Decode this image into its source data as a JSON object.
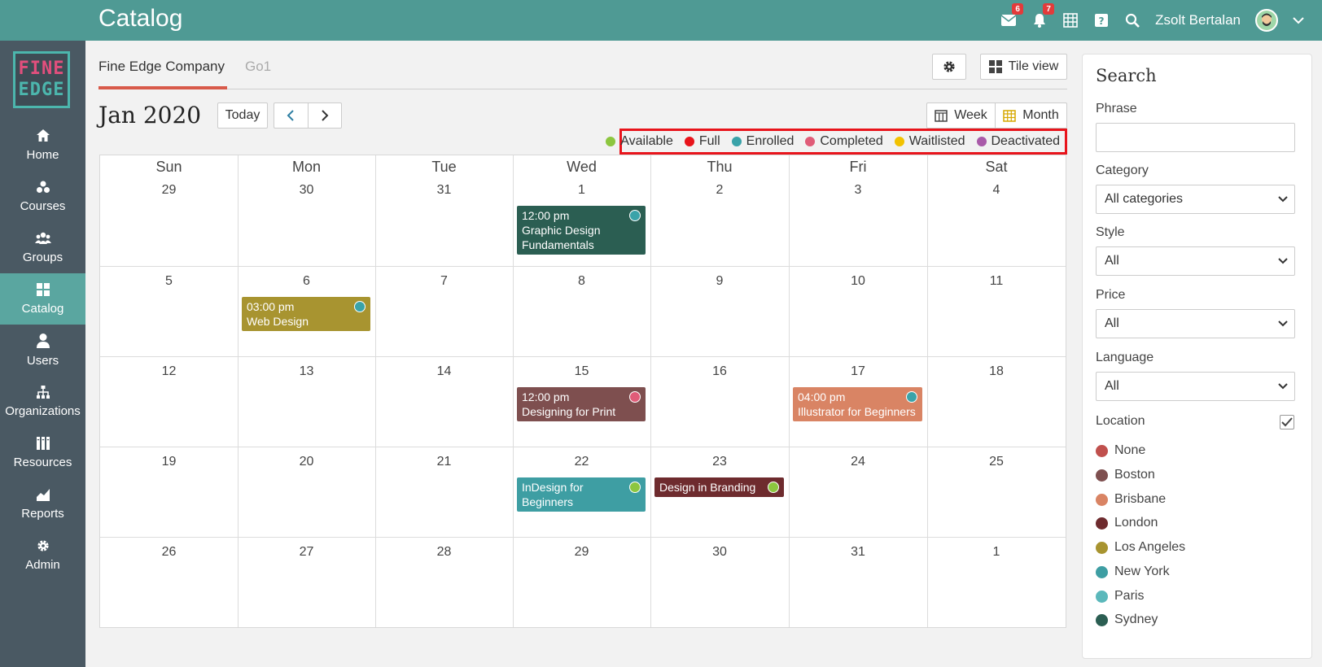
{
  "header": {
    "title": "Catalog",
    "messages_badge": "6",
    "notifications_badge": "7",
    "user_name": "Zsolt Bertalan"
  },
  "logo": {
    "line1": "FINE",
    "line2": "EDGE"
  },
  "sidebar": {
    "items": [
      {
        "label": "Home",
        "icon": "home-icon"
      },
      {
        "label": "Courses",
        "icon": "courses-icon"
      },
      {
        "label": "Groups",
        "icon": "groups-icon"
      },
      {
        "label": "Catalog",
        "icon": "catalog-icon",
        "active": true
      },
      {
        "label": "Users",
        "icon": "user-icon"
      },
      {
        "label": "Organizations",
        "icon": "org-chart-icon"
      },
      {
        "label": "Resources",
        "icon": "resources-icon"
      },
      {
        "label": "Reports",
        "icon": "reports-icon"
      },
      {
        "label": "Admin",
        "icon": "gear-icon"
      }
    ]
  },
  "tabs": [
    {
      "label": "Fine Edge Company",
      "active": true
    },
    {
      "label": "Go1",
      "active": false
    }
  ],
  "toolbar": {
    "tile_view_label": "Tile view",
    "today_label": "Today",
    "week_label": "Week",
    "month_label": "Month"
  },
  "calendar": {
    "title": "Jan 2020",
    "weekdays": [
      "Sun",
      "Mon",
      "Tue",
      "Wed",
      "Thu",
      "Fri",
      "Sat"
    ],
    "weeks": [
      [
        "29",
        "30",
        "31",
        "1",
        "2",
        "3",
        "4"
      ],
      [
        "5",
        "6",
        "7",
        "8",
        "9",
        "10",
        "11"
      ],
      [
        "12",
        "13",
        "14",
        "15",
        "16",
        "17",
        "18"
      ],
      [
        "19",
        "20",
        "21",
        "22",
        "23",
        "24",
        "25"
      ],
      [
        "26",
        "27",
        "28",
        "29",
        "30",
        "31",
        "1"
      ]
    ],
    "events": [
      {
        "time": "12:00 pm",
        "title": "Graphic Design",
        "title2": "Fundamentals",
        "color": "#2b5e52",
        "status_color": "#3aa3a9"
      },
      {
        "time": "03:00 pm",
        "title": "Web Design",
        "color": "#a89430",
        "status_color": "#3aa3a9"
      },
      {
        "time": "12:00 pm",
        "title": "Designing for Print",
        "color": "#7e4f4f",
        "status_color": "#e05c78"
      },
      {
        "time": "04:00 pm",
        "title": "Illustrator for Beginners",
        "color": "#d98464",
        "status_color": "#3aa3a9"
      },
      {
        "title": "InDesign for",
        "title2": "Beginners",
        "color": "#3e9ea3",
        "status_color": "#8cc63f"
      },
      {
        "title": "Design in Branding",
        "color": "#6e2b2e",
        "status_color": "#8cc63f"
      }
    ]
  },
  "legend": [
    {
      "label": "Available",
      "color": "#8cc63f"
    },
    {
      "label": "Full",
      "color": "#e8141b"
    },
    {
      "label": "Enrolled",
      "color": "#3aa3a9"
    },
    {
      "label": "Completed",
      "color": "#e05c78"
    },
    {
      "label": "Waitlisted",
      "color": "#f2c200"
    },
    {
      "label": "Deactivated",
      "color": "#a95aa9"
    }
  ],
  "search": {
    "title": "Search",
    "phrase_label": "Phrase",
    "phrase_value": "",
    "category_label": "Category",
    "category_value": "All categories",
    "style_label": "Style",
    "style_value": "All",
    "price_label": "Price",
    "price_value": "All",
    "language_label": "Language",
    "language_value": "All",
    "location_label": "Location",
    "location_checked": true,
    "locations": [
      {
        "label": "None",
        "color": "#c0504d"
      },
      {
        "label": "Boston",
        "color": "#7e4f4f"
      },
      {
        "label": "Brisbane",
        "color": "#d98464"
      },
      {
        "label": "London",
        "color": "#6e2b2e"
      },
      {
        "label": "Los Angeles",
        "color": "#a89430"
      },
      {
        "label": "New York",
        "color": "#3e9ea3"
      },
      {
        "label": "Paris",
        "color": "#5bb8bb"
      },
      {
        "label": "Sydney",
        "color": "#2b5e52"
      }
    ]
  }
}
